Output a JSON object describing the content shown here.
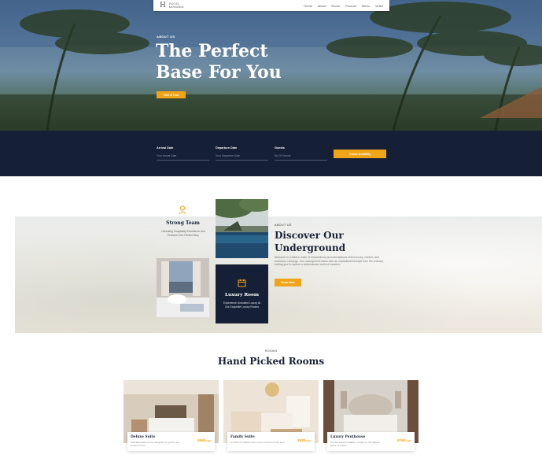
{
  "nav": {
    "logo_mark": "H",
    "logo_line1": "HOTEL",
    "logo_line2": "MIRANDA",
    "links": [
      "Home",
      "About",
      "Room",
      "Product",
      "Menu",
      "Video"
    ]
  },
  "hero": {
    "tag": "ABOUT US",
    "title_line1": "The Perfect",
    "title_line2": "Base For You",
    "button": "Take A Tour"
  },
  "booking": {
    "arrival_label": "Arrival Date",
    "arrival_placeholder": "Your Arrival Date",
    "departure_label": "Departure Date",
    "departure_placeholder": "Your Departure Date",
    "guests_label": "Guests",
    "guests_placeholder": "No Of Guests",
    "button": "Check Avaibility"
  },
  "about": {
    "team_title": "Strong Team",
    "team_desc": "Unlocking Hospitality Excellence And Ensures Your Perfect Stay",
    "lux_title": "Luxury Room",
    "lux_desc": "Experience Unrivaled Luxury At Our Exquisite Luxury Rooms",
    "tag": "ABOUT US",
    "title": "Discover Our Underground",
    "desc": "Welcome to a hidden realm of extraordinary accommodations where luxury, comfort, and adventure converge. Our underground hotels offer an unparalleled escape from the ordinary, inviting you to explore a subterranean world of wonders.",
    "button": "Book Now"
  },
  "rooms": {
    "tag": "ROOMS",
    "title": "Hand Picked Rooms",
    "items": [
      {
        "name": "Deluxe Suite",
        "desc": "Well-appointed rooms designed for guests who desire a more",
        "price": "$560",
        "per": "/night"
      },
      {
        "name": "Family Suite",
        "desc": "Consist of multiple rooms and a common living area",
        "price": "$620",
        "per": "/night"
      },
      {
        "name": "Luxury Penthouse",
        "desc": "Top-tier accommodation, usually on the highest floors of a hotel",
        "price": "$760",
        "per": "/night"
      }
    ]
  },
  "colors": {
    "accent": "#f0a418",
    "navy": "#152036"
  }
}
